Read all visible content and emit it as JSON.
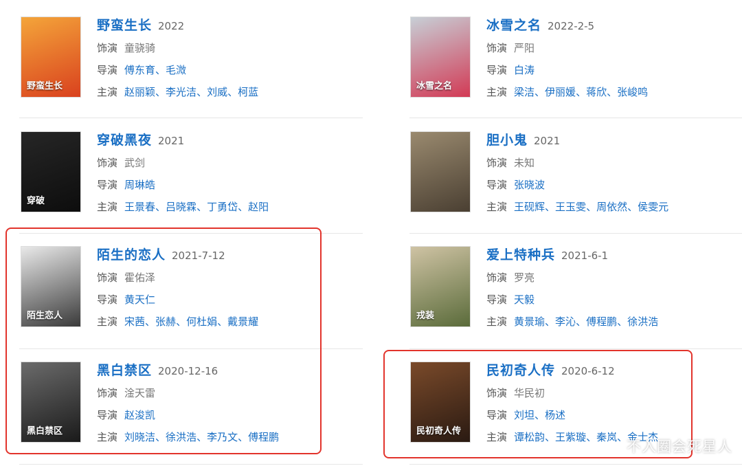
{
  "labels": {
    "role": "饰演",
    "director": "导演",
    "cast": "主演",
    "separator": "、"
  },
  "items": [
    {
      "title": "野蛮生长",
      "date": "2022",
      "role": "童骁骑",
      "directors": [
        "傅东育",
        "毛溦"
      ],
      "cast": [
        "赵丽颖",
        "李光洁",
        "刘威",
        "柯蓝"
      ],
      "poster_text": "野蛮生长",
      "colors": [
        "#f4a53a",
        "#d9411e"
      ]
    },
    {
      "title": "冰雪之名",
      "date": "2022-2-5",
      "role": "严阳",
      "directors": [
        "白涛"
      ],
      "cast": [
        "梁洁",
        "伊丽媛",
        "蒋欣",
        "张峻鸣"
      ],
      "poster_text": "冰雪之名",
      "colors": [
        "#c7cfd6",
        "#d23a55"
      ]
    },
    {
      "title": "穿破黑夜",
      "date": "2021",
      "role": "武剑",
      "directors": [
        "周琳皓"
      ],
      "cast": [
        "王景春",
        "吕晓霖",
        "丁勇岱",
        "赵阳"
      ],
      "poster_text": "穿破",
      "colors": [
        "#262626",
        "#0d0d0d"
      ]
    },
    {
      "title": "胆小鬼",
      "date": "2021",
      "role": "未知",
      "directors": [
        "张晓波"
      ],
      "cast": [
        "王砚辉",
        "王玉雯",
        "周依然",
        "侯雯元"
      ],
      "poster_text": "",
      "colors": [
        "#9a8a6f",
        "#4a3f32"
      ]
    },
    {
      "title": "陌生的恋人",
      "date": "2021-7-12",
      "role": "霍佑泽",
      "directors": [
        "黄天仁"
      ],
      "cast": [
        "宋茜",
        "张赫",
        "何杜娟",
        "戴景耀"
      ],
      "poster_text": "陌生恋人",
      "colors": [
        "#e9e9e9",
        "#3a3a3a"
      ]
    },
    {
      "title": "爱上特种兵",
      "date": "2021-6-1",
      "role": "罗亮",
      "directors": [
        "天毅"
      ],
      "cast": [
        "黄景瑜",
        "李沁",
        "傅程鹏",
        "徐洪浩"
      ],
      "poster_text": "戎装",
      "colors": [
        "#cfc3a4",
        "#5a6b3a"
      ]
    },
    {
      "title": "黑白禁区",
      "date": "2020-12-16",
      "role": "淦天雷",
      "directors": [
        "赵浚凯"
      ],
      "cast": [
        "刘晓洁",
        "徐洪浩",
        "李乃文",
        "傅程鹏"
      ],
      "poster_text": "黑白禁区",
      "colors": [
        "#6b6b6b",
        "#1a1a1a"
      ]
    },
    {
      "title": "民初奇人传",
      "date": "2020-6-12",
      "role": "华民初",
      "directors": [
        "刘坦",
        "杨述"
      ],
      "cast": [
        "谭松韵",
        "王紫璇",
        "秦岚",
        "金士杰"
      ],
      "poster_text": "民初奇人传",
      "colors": [
        "#7a4a2a",
        "#2a1a12"
      ]
    }
  ],
  "watermark": "不入圈会死星人"
}
